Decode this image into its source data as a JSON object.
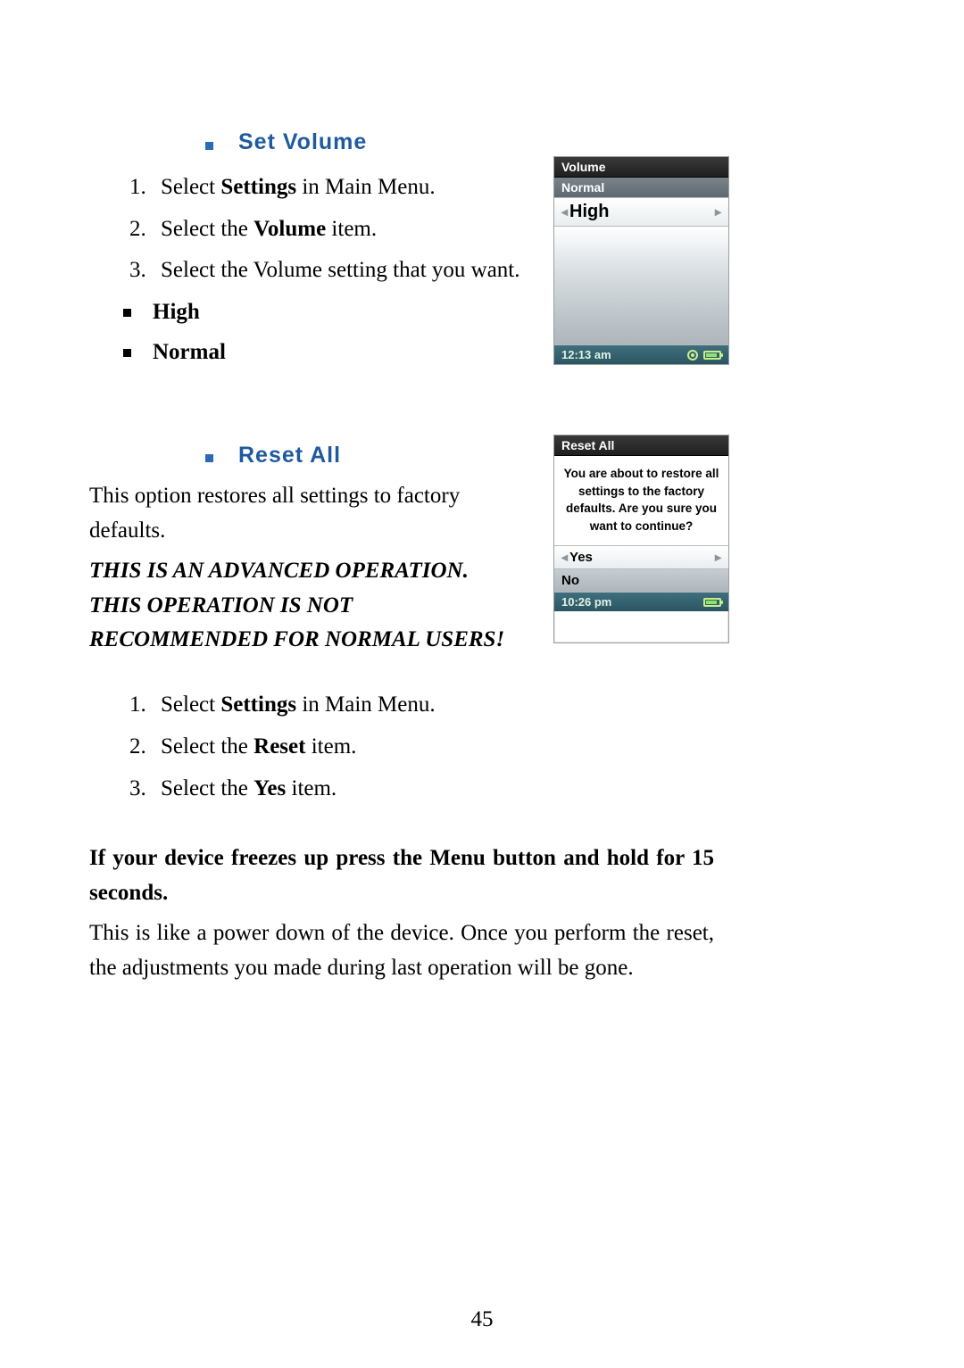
{
  "section1": {
    "title": "Set Volume",
    "steps": [
      {
        "pre": "Select ",
        "bold": "Settings",
        "post": " in Main Menu."
      },
      {
        "pre": "Select the ",
        "bold": "Volume",
        "post": " item."
      },
      {
        "pre": "Select the Volume setting that you want.",
        "bold": "",
        "post": ""
      }
    ],
    "options": [
      "High",
      "Normal"
    ]
  },
  "section2": {
    "title": "Reset All",
    "intro": "This option restores all settings to factory defaults.",
    "warning": "THIS IS AN ADVANCED OPERATION. THIS OPERATION IS NOT RECOMMENDED FOR NORMAL USERS!",
    "steps": [
      {
        "pre": "Select ",
        "bold": "Settings",
        "post": " in Main Menu."
      },
      {
        "pre": "Select the ",
        "bold": "Reset",
        "post": " item."
      },
      {
        "pre": "Select the ",
        "bold": "Yes",
        "post": " item."
      }
    ]
  },
  "freeze": {
    "heading": "If your device freezes up press the Menu button and hold for 15 seconds.",
    "body": "This is like a power down of the device. Once you perform the reset, the adjustments you made during last operation will be gone."
  },
  "deviceVolume": {
    "title": "Volume",
    "row_normal": "Normal",
    "row_selected": "High",
    "time": "12:13 am"
  },
  "deviceReset": {
    "title": "Reset All",
    "message": "You are about to restore all settings to the factory defaults.  Are you sure you want to continue?",
    "row_yes": "Yes",
    "row_no": "No",
    "time": "10:26 pm"
  },
  "pageNumber": "45",
  "glyphs": {
    "tri_left": "◂",
    "tri_right": "▸"
  }
}
